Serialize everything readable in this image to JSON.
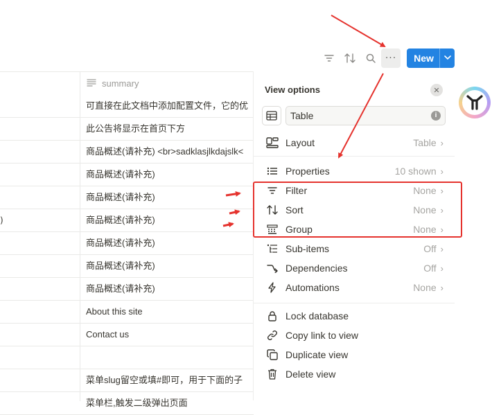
{
  "toolbar": {
    "icons": [
      "filter-icon",
      "sort-icon",
      "search-icon",
      "more-icon"
    ],
    "new_label": "New",
    "more_glyph": "···"
  },
  "table": {
    "column_header": "summary",
    "rows": [
      {
        "left": "",
        "summary": "可直接在此文档中添加配置文件，它的优"
      },
      {
        "left": "",
        "summary": "此公告将显示在首页下方"
      },
      {
        "left": "",
        "summary": "商品概述(请补充) <br>sadklasjlkdajslk<"
      },
      {
        "left": "",
        "summary": "商品概述(请补充)"
      },
      {
        "left": "",
        "summary": "商品概述(请补充)"
      },
      {
        "left": ")",
        "summary": "商品概述(请补充)"
      },
      {
        "left": "",
        "summary": "商品概述(请补充)"
      },
      {
        "left": "",
        "summary": "商品概述(请补充)"
      },
      {
        "left": "",
        "summary": "商品概述(请补充)"
      },
      {
        "left": "",
        "summary": "About this site"
      },
      {
        "left": "",
        "summary": "Contact us"
      },
      {
        "left": "",
        "summary": ""
      },
      {
        "left": "",
        "summary": "菜单slug留空或填#即可，用于下面的子"
      },
      {
        "left": "",
        "summary": "菜单栏,触发二级弹出页面"
      }
    ]
  },
  "panel": {
    "title": "View options",
    "view_name": "Table",
    "items": [
      {
        "name": "layout",
        "icon": "layout-icon",
        "label": "Layout",
        "value": "Table"
      },
      {
        "name": "properties",
        "icon": "properties-icon",
        "label": "Properties",
        "value": "10 shown"
      },
      {
        "name": "filter",
        "icon": "filter-icon",
        "label": "Filter",
        "value": "None"
      },
      {
        "name": "sort",
        "icon": "sort-icon",
        "label": "Sort",
        "value": "None"
      },
      {
        "name": "group",
        "icon": "group-icon",
        "label": "Group",
        "value": "None"
      },
      {
        "name": "sub-items",
        "icon": "sub-items-icon",
        "label": "Sub-items",
        "value": "Off"
      },
      {
        "name": "dependencies",
        "icon": "dependencies-icon",
        "label": "Dependencies",
        "value": "Off"
      },
      {
        "name": "automations",
        "icon": "automations-icon",
        "label": "Automations",
        "value": "None"
      }
    ],
    "actions": [
      {
        "name": "lock-database",
        "icon": "lock-icon",
        "label": "Lock database"
      },
      {
        "name": "copy-link",
        "icon": "link-icon",
        "label": "Copy link to view"
      },
      {
        "name": "duplicate-view",
        "icon": "duplicate-icon",
        "label": "Duplicate view"
      },
      {
        "name": "delete-view",
        "icon": "trash-icon",
        "label": "Delete view"
      }
    ]
  },
  "colors": {
    "accent": "#2383e2",
    "annotation_red": "#e5322d",
    "muted_text": "#a5a4a1"
  }
}
